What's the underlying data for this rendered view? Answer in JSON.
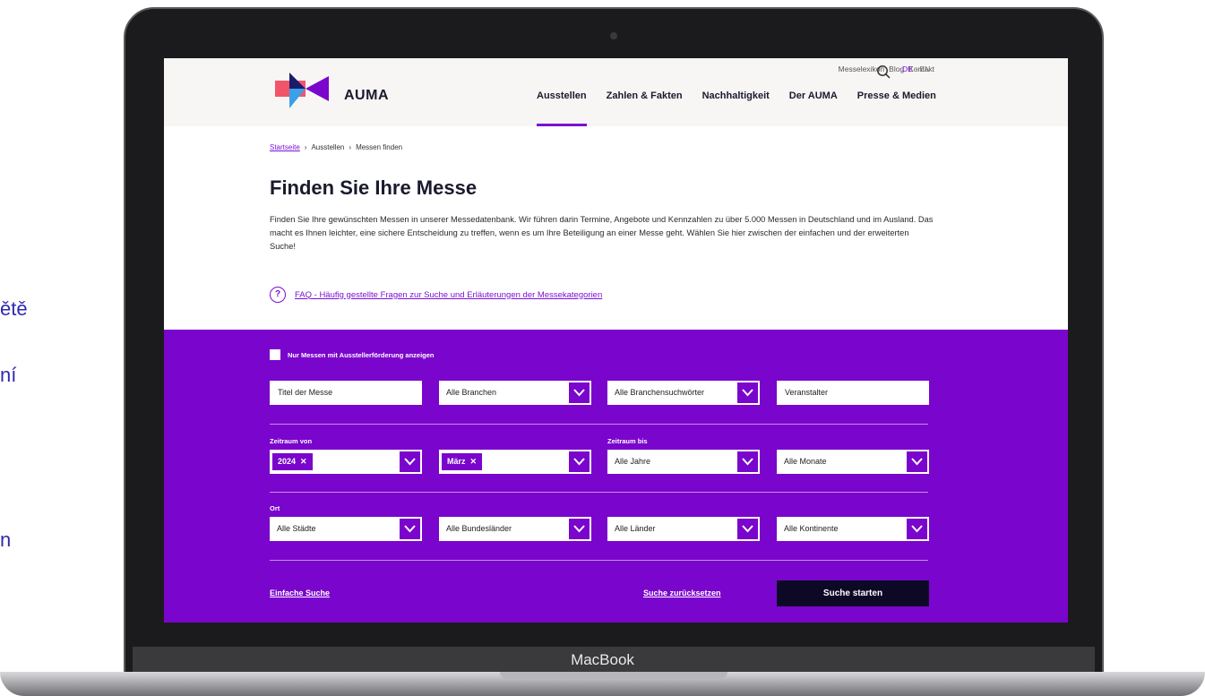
{
  "background": {
    "left_text_1": "ětě",
    "left_text_2": "ní",
    "left_text_3": "n"
  },
  "device": {
    "label": "MacBook"
  },
  "header": {
    "logo_text": "AUMA",
    "util_links": [
      "Messelexikon",
      "Blog",
      "Kontakt"
    ],
    "lang_active": "DE",
    "lang_sep": "·",
    "lang_other": "EN",
    "nav": [
      "Ausstellen",
      "Zahlen & Fakten",
      "Nachhaltigkeit",
      "Der AUMA",
      "Presse & Medien"
    ],
    "active_nav": "Ausstellen"
  },
  "breadcrumb": {
    "home": "Startseite",
    "sep": "›",
    "level2": "Ausstellen",
    "current": "Messen finden"
  },
  "page": {
    "title": "Finden Sie Ihre Messe",
    "intro": "Finden Sie Ihre gewünschten Messen in unserer Messedatenbank. Wir führen darin Termine, Angebote und Kennzahlen zu über 5.000 Messen in Deutschland und im Ausland. Das macht es Ihnen leichter, eine sichere Entscheidung zu treffen, wenn es um Ihre Beteiligung an einer Messe geht. Wählen Sie hier zwischen der einfachen und der erweiterten Suche!",
    "faq_icon_glyph": "?",
    "faq_link": "FAQ - Häufig gestellte Fragen zur Suche und Erläuterungen der Messekategorien"
  },
  "search": {
    "checkbox_label": "Nur Messen mit Ausstellerförderung anzeigen",
    "title_placeholder": "Titel der Messe",
    "branchen": "Alle Branchen",
    "branchensuchwoerter": "Alle Branchensuchwörter",
    "veranstalter_placeholder": "Veranstalter",
    "zeitraum_von_label": "Zeitraum von",
    "zeitraum_bis_label": "Zeitraum bis",
    "von_year_tag": "2024",
    "von_month_tag": "März",
    "tag_remove_glyph": "✕",
    "bis_year": "Alle Jahre",
    "bis_month": "Alle Monate",
    "ort_label": "Ort",
    "staedte": "Alle Städte",
    "bundeslaender": "Alle Bundesländer",
    "laender": "Alle Länder",
    "kontinente": "Alle Kontinente",
    "simple_search_link": "Einfache Suche",
    "reset_link": "Suche zurücksetzen",
    "submit_label": "Suche starten"
  },
  "colors": {
    "brand_purple": "#7a05cc",
    "dark_button": "#0c0826",
    "header_bg": "#f7f6f4"
  }
}
